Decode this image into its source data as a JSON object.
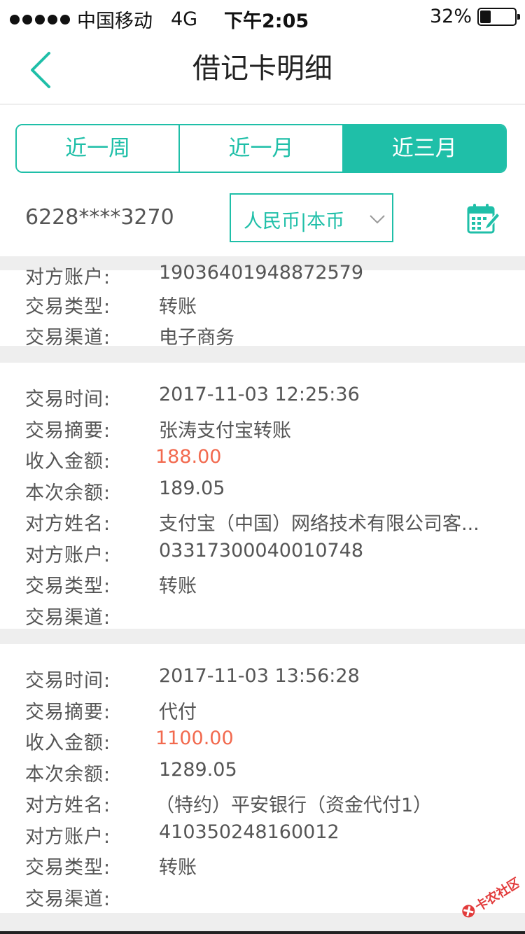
{
  "status_bar": {
    "carrier": "中国移动",
    "network": "4G",
    "time": "下午2:05",
    "battery": "32%",
    "battery_level": 0.32
  },
  "nav": {
    "title": "借记卡明细",
    "back_icon": "chevron-left-icon"
  },
  "tabs": [
    {
      "label": "近一周",
      "active": false
    },
    {
      "label": "近一月",
      "active": false
    },
    {
      "label": "近三月",
      "active": true
    }
  ],
  "account": {
    "card_number": "6228****3270",
    "currency": "人民币|本币",
    "calendar_icon": "calendar-edit-icon"
  },
  "accent_color": "#1fbfa8",
  "amount_color": "#f26a4f",
  "transactions": [
    {
      "partial": true,
      "rows": [
        {
          "label": "对方账户:",
          "value": "19036401948872579"
        },
        {
          "label": "交易类型:",
          "value": "转账"
        },
        {
          "label": "交易渠道:",
          "value": "电子商务"
        }
      ]
    },
    {
      "rows": [
        {
          "label": "交易时间:",
          "value": "2017-11-03 12:25:36"
        },
        {
          "label": "交易摘要:",
          "value": "张涛支付宝转账"
        },
        {
          "label": "收入金额:",
          "value": "188.00"
        },
        {
          "label": "本次余额:",
          "value": "189.05"
        },
        {
          "label": "对方姓名:",
          "value": "支付宝（中国）网络技术有限公司客..."
        },
        {
          "label": "对方账户:",
          "value": "03317300040010748"
        },
        {
          "label": "交易类型:",
          "value": "转账"
        },
        {
          "label": "交易渠道:",
          "value": ""
        }
      ]
    },
    {
      "rows": [
        {
          "label": "交易时间:",
          "value": "2017-11-03 13:56:28"
        },
        {
          "label": "交易摘要:",
          "value": "代付"
        },
        {
          "label": "收入金额:",
          "value": "1100.00"
        },
        {
          "label": "本次余额:",
          "value": "1289.05"
        },
        {
          "label": "对方姓名:",
          "value": "（特约）平安银行（资金代付1）"
        },
        {
          "label": "对方账户:",
          "value": "410350248160012"
        },
        {
          "label": "交易类型:",
          "value": "转账"
        },
        {
          "label": "交易渠道:",
          "value": ""
        }
      ]
    }
  ],
  "watermark": "卡农社区"
}
